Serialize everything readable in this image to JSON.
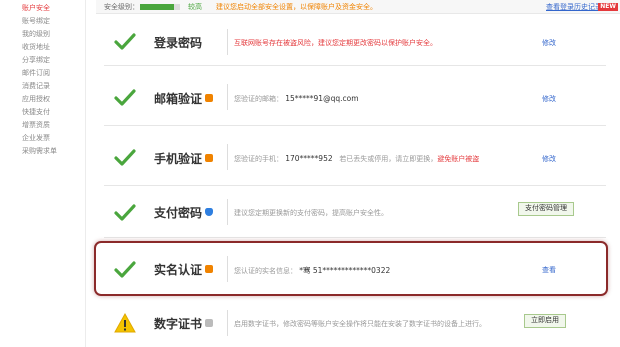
{
  "sidebar": {
    "items": [
      {
        "label": "账户安全",
        "active": true
      },
      {
        "label": "账号绑定",
        "active": false
      },
      {
        "label": "我的级别",
        "active": false
      },
      {
        "label": "收货地址",
        "active": false
      },
      {
        "label": "分享绑定",
        "active": false
      },
      {
        "label": "邮件订阅",
        "active": false
      },
      {
        "label": "消费记录",
        "active": false
      },
      {
        "label": "应用授权",
        "active": false
      },
      {
        "label": "快捷支付",
        "active": false
      },
      {
        "label": "增票资质",
        "active": false
      },
      {
        "label": "企业发票",
        "active": false
      },
      {
        "label": "采购需求单",
        "active": false
      }
    ]
  },
  "topbar": {
    "level_label": "安全级别：",
    "level_fraction": 0.85,
    "level_text": "较高",
    "hint": "建议您启动全部安全设置，以保障账户及资金安全。",
    "history_link": "查看登录历史记录",
    "new_badge": "NEW"
  },
  "colors": {
    "check_green": "#4aa63d",
    "warn_yellow": "#f3c300",
    "link_blue": "#3366cc",
    "alert_red": "#e4393c",
    "highlight_border": "#8b2a2a"
  },
  "rows": {
    "password": {
      "title": "登录密码",
      "desc": "互联网账号存在被盗风险，建议您定期更改密码以保护账户安全。",
      "action": "修改"
    },
    "email": {
      "title": "邮箱验证",
      "desc_prefix": "您验证的邮箱：",
      "desc_value": "15*****91@qq.com",
      "action": "修改"
    },
    "phone": {
      "title": "手机验证",
      "desc_prefix": "您验证的手机：",
      "desc_value": "170*****952",
      "desc_suffix": "若已丢失或停用，请立即更换，",
      "desc_warn": "避免账户被盗",
      "action": "修改"
    },
    "paypwd": {
      "title": "支付密码",
      "desc": "建议您定期更换新的支付密码，提高账户安全性。",
      "button": "支付密码管理"
    },
    "realname": {
      "title": "实名认证",
      "desc_prefix": "您认证的实名信息：",
      "desc_value": "*骞 51*************0322",
      "action": "查看"
    },
    "cert": {
      "title": "数字证书",
      "desc": "启用数字证书，修改密码等账户安全操作将只能在安装了数字证书的设备上进行。",
      "button": "立即启用"
    }
  }
}
